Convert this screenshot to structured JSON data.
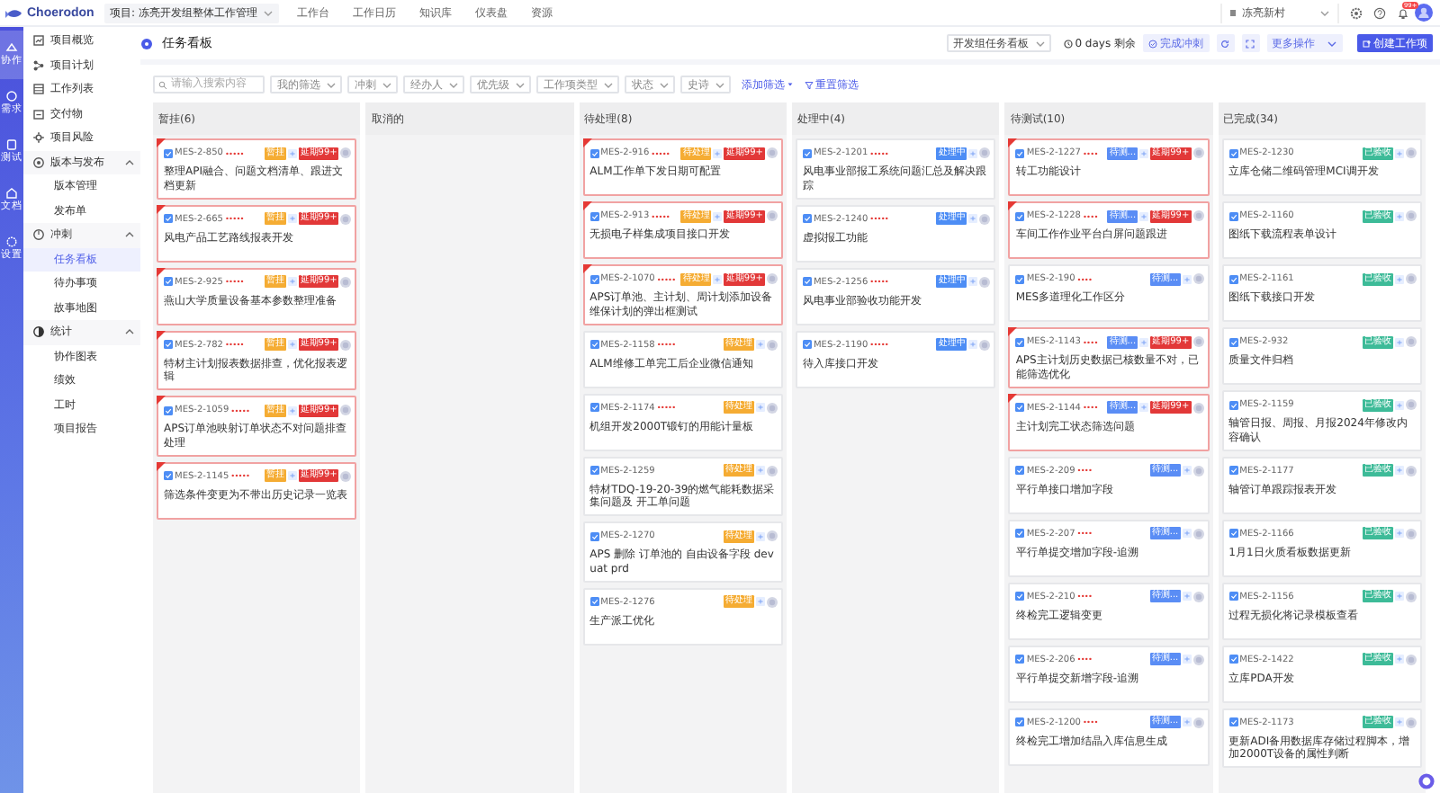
{
  "topbar": {
    "logo": "Choerodon",
    "project": "项目: 冻亮开发组整体工作管理",
    "nav": [
      "工作台",
      "工作日历",
      "知识库",
      "仪表盘",
      "资源"
    ],
    "org": "冻亮新村",
    "notification_badge": "99+"
  },
  "rail": [
    {
      "label": "协作",
      "selected": true
    },
    {
      "label": "需求",
      "selected": false
    },
    {
      "label": "测试",
      "selected": false
    },
    {
      "label": "文档",
      "selected": false
    },
    {
      "label": "设置",
      "selected": false
    }
  ],
  "sidebar": {
    "items": [
      {
        "label": "项目概览",
        "selected": false
      },
      {
        "label": "项目计划",
        "selected": false
      },
      {
        "label": "工作列表",
        "selected": false
      },
      {
        "label": "交付物",
        "selected": false
      },
      {
        "label": "项目风险",
        "selected": false
      },
      {
        "label": "版本与发布",
        "expanded": true,
        "children": [
          {
            "label": "版本管理",
            "selected": false
          },
          {
            "label": "发布单",
            "selected": false
          }
        ]
      },
      {
        "label": "冲刺",
        "expanded": true,
        "children": [
          {
            "label": "任务看板",
            "selected": true
          },
          {
            "label": "待办事项",
            "selected": false
          },
          {
            "label": "故事地图",
            "selected": false
          }
        ]
      },
      {
        "label": "统计",
        "expanded": true,
        "children": [
          {
            "label": "协作图表",
            "selected": false
          },
          {
            "label": "绩效",
            "selected": false
          },
          {
            "label": "工时",
            "selected": false
          },
          {
            "label": "项目报告",
            "selected": false
          }
        ]
      }
    ]
  },
  "page": {
    "title": "任务看板"
  },
  "toolbar": {
    "board": "开发组任务看板",
    "remaining": "0 days 剩余",
    "complete": "完成冲刺",
    "more": "更多操作",
    "create": "创建工作项"
  },
  "filters": {
    "search": {
      "placeholder": "请输入搜索内容"
    },
    "selects": [
      "我的筛选",
      "冲刺",
      "经办人",
      "优先级",
      "工作项类型",
      "状态",
      "史诗"
    ],
    "add": "添加筛选",
    "reset": "重置筛选"
  },
  "columns": [
    {
      "title": "暂挂(6)",
      "cards": [
        {
          "id": "MES-2-850",
          "masked": "•••••",
          "status": {
            "label": "暂挂",
            "color": "#f5ac33"
          },
          "overdue": true,
          "delay": "延期99+",
          "title": "整理API融合、问题文档清单、跟进文档更新"
        },
        {
          "id": "MES-2-665",
          "masked": "•••••",
          "status": {
            "label": "暂挂",
            "color": "#f5ac33"
          },
          "overdue": true,
          "delay": "延期99+",
          "title": "风电产品工艺路线报表开发"
        },
        {
          "id": "MES-2-925",
          "masked": "•••••",
          "status": {
            "label": "暂挂",
            "color": "#f5ac33"
          },
          "overdue": true,
          "delay": "延期99+",
          "title": "燕山大学质量设备基本参数整理准备"
        },
        {
          "id": "MES-2-782",
          "masked": "•••••",
          "status": {
            "label": "暂挂",
            "color": "#f5ac33"
          },
          "overdue": true,
          "delay": "延期99+",
          "title": "特材主计划报表数据排查，优化报表逻辑"
        },
        {
          "id": "MES-2-1059",
          "masked": "•••••",
          "status": {
            "label": "暂挂",
            "color": "#f5ac33"
          },
          "overdue": true,
          "delay": "延期99+",
          "title": "APS订单池映射订单状态不对问题排查处理"
        },
        {
          "id": "MES-2-1145",
          "masked": "•••••",
          "status": {
            "label": "暂挂",
            "color": "#f5ac33"
          },
          "overdue": true,
          "delay": "延期99+",
          "title": "筛选条件变更为不带出历史记录一览表"
        }
      ]
    },
    {
      "title": "取消的"
    },
    {
      "title": "待处理(8)",
      "cards": [
        {
          "id": "MES-2-916",
          "masked": "•••••",
          "status": {
            "label": "待处理",
            "color": "#f5ac33"
          },
          "overdue": true,
          "delay": "延期99+",
          "title": "ALM工作单下发日期可配置"
        },
        {
          "id": "MES-2-913",
          "masked": "•••••",
          "status": {
            "label": "待处理",
            "color": "#f5ac33"
          },
          "overdue": true,
          "delay": "延期99+",
          "title": "无损电子样集成项目接口开发"
        },
        {
          "id": "MES-2-1070",
          "masked": "•••••",
          "status": {
            "label": "待处理",
            "color": "#f5ac33"
          },
          "overdue": true,
          "delay": "延期99+",
          "title": "APS订单池、主计划、周计划添加设备维保计划的弹出框测试"
        },
        {
          "id": "MES-2-1158",
          "masked": "•••••",
          "status": {
            "label": "待处理",
            "color": "#f5ac33"
          },
          "overdue": false,
          "title": "ALM维修工单完工后企业微信通知"
        },
        {
          "id": "MES-2-1174",
          "masked": "•••••",
          "status": {
            "label": "待处理",
            "color": "#f5ac33"
          },
          "overdue": false,
          "title": "机组开发2000T锻钉的用能计量板"
        },
        {
          "id": "MES-2-1259",
          "status": {
            "label": "待处理",
            "color": "#f5ac33"
          },
          "overdue": false,
          "title": "特材TDQ-19-20-39的燃气能耗数据采集问题及 开工单问题"
        },
        {
          "id": "MES-2-1270",
          "status": {
            "label": "待处理",
            "color": "#f5ac33"
          },
          "overdue": false,
          "title": "APS 删除 订单池的 自由设备字段 dev uat prd"
        },
        {
          "id": "MES-2-1276",
          "status": {
            "label": "待处理",
            "color": "#f5ac33"
          },
          "overdue": false,
          "title": "生产派工优化"
        }
      ]
    },
    {
      "title": "处理中(4)",
      "cards": [
        {
          "id": "MES-2-1201",
          "masked": "•••••",
          "status": {
            "label": "处理中",
            "color": "#4d8df5"
          },
          "overdue": false,
          "title": "风电事业部报工系统问题汇总及解决跟踪"
        },
        {
          "id": "MES-2-1240",
          "masked": "•••••",
          "status": {
            "label": "处理中",
            "color": "#4d8df5"
          },
          "overdue": false,
          "title": "虚拟报工功能"
        },
        {
          "id": "MES-2-1256",
          "masked": "•••••",
          "status": {
            "label": "处理中",
            "color": "#4d8df5"
          },
          "overdue": false,
          "title": "风电事业部验收功能开发"
        },
        {
          "id": "MES-2-1190",
          "masked": "•••••",
          "status": {
            "label": "处理中",
            "color": "#4d8df5"
          },
          "overdue": false,
          "title": "待入库接口开发"
        }
      ]
    },
    {
      "title": "待测试(10)",
      "cards": [
        {
          "id": "MES-2-1227",
          "masked": "••••",
          "status": {
            "label": "待测...",
            "color": "#5a8df5"
          },
          "overdue": true,
          "delay": "延期99+",
          "title": "转工功能设计"
        },
        {
          "id": "MES-2-1228",
          "masked": "••••",
          "status": {
            "label": "待测...",
            "color": "#5a8df5"
          },
          "overdue": true,
          "delay": "延期99+",
          "title": "车间工作作业平台白屏问题跟进"
        },
        {
          "id": "MES-2-190",
          "masked": "••••",
          "status": {
            "label": "待测...",
            "color": "#5a8df5"
          },
          "overdue": false,
          "title": "MES多道理化工作区分"
        },
        {
          "id": "MES-2-1143",
          "masked": "••••",
          "status": {
            "label": "待测...",
            "color": "#5a8df5"
          },
          "overdue": true,
          "delay": "延期99+",
          "title": "APS主计划历史数据已核数量不对，已能筛选优化"
        },
        {
          "id": "MES-2-1144",
          "masked": "••••",
          "status": {
            "label": "待测...",
            "color": "#5a8df5"
          },
          "overdue": true,
          "delay": "延期99+",
          "title": "主计划完工状态筛选问题"
        },
        {
          "id": "MES-2-209",
          "masked": "••••",
          "status": {
            "label": "待测...",
            "color": "#5a8df5"
          },
          "overdue": false,
          "title": "平行单接口增加字段"
        },
        {
          "id": "MES-2-207",
          "masked": "••••",
          "status": {
            "label": "待测...",
            "color": "#5a8df5"
          },
          "overdue": false,
          "title": "平行单提交增加字段-追溯"
        },
        {
          "id": "MES-2-210",
          "masked": "••••",
          "status": {
            "label": "待测...",
            "color": "#5a8df5"
          },
          "overdue": false,
          "title": "终检完工逻辑变更"
        },
        {
          "id": "MES-2-206",
          "masked": "••••",
          "status": {
            "label": "待测...",
            "color": "#5a8df5"
          },
          "overdue": false,
          "title": "平行单提交新增字段-追溯"
        },
        {
          "id": "MES-2-1200",
          "masked": "••••",
          "status": {
            "label": "待测...",
            "color": "#5a8df5"
          },
          "overdue": false,
          "title": "终检完工增加结晶入库信息生成"
        }
      ]
    },
    {
      "title": "已完成(34)",
      "cards": [
        {
          "id": "MES-2-1230",
          "status": {
            "label": "已验收",
            "color": "#3dbb98"
          },
          "overdue": false,
          "title": "立库仓储二维码管理MCI调开发"
        },
        {
          "id": "MES-2-1160",
          "status": {
            "label": "已验收",
            "color": "#3dbb98"
          },
          "overdue": false,
          "title": "图纸下载流程表单设计"
        },
        {
          "id": "MES-2-1161",
          "status": {
            "label": "已验收",
            "color": "#3dbb98"
          },
          "overdue": false,
          "title": "图纸下载接口开发"
        },
        {
          "id": "MES-2-932",
          "status": {
            "label": "已验收",
            "color": "#3dbb98"
          },
          "overdue": false,
          "title": "质量文件归档"
        },
        {
          "id": "MES-2-1159",
          "status": {
            "label": "已验收",
            "color": "#3dbb98"
          },
          "overdue": false,
          "title": "轴管日报、周报、月报2024年修改内容确认"
        },
        {
          "id": "MES-2-1177",
          "status": {
            "label": "已验收",
            "color": "#3dbb98"
          },
          "overdue": false,
          "title": "轴管订单跟踪报表开发"
        },
        {
          "id": "MES-2-1166",
          "status": {
            "label": "已验收",
            "color": "#3dbb98"
          },
          "overdue": false,
          "title": "1月1日火质看板数据更新"
        },
        {
          "id": "MES-2-1156",
          "status": {
            "label": "已验收",
            "color": "#3dbb98"
          },
          "overdue": false,
          "title": "过程无损化将记录模板查看"
        },
        {
          "id": "MES-2-1422",
          "status": {
            "label": "已验收",
            "color": "#3dbb98"
          },
          "overdue": false,
          "title": "立库PDA开发"
        },
        {
          "id": "MES-2-1173",
          "status": {
            "label": "已验收",
            "color": "#3dbb98"
          },
          "overdue": false,
          "title": "更新ADI备用数据库存储过程脚本，增加2000T设备的属性判断"
        }
      ]
    }
  ]
}
